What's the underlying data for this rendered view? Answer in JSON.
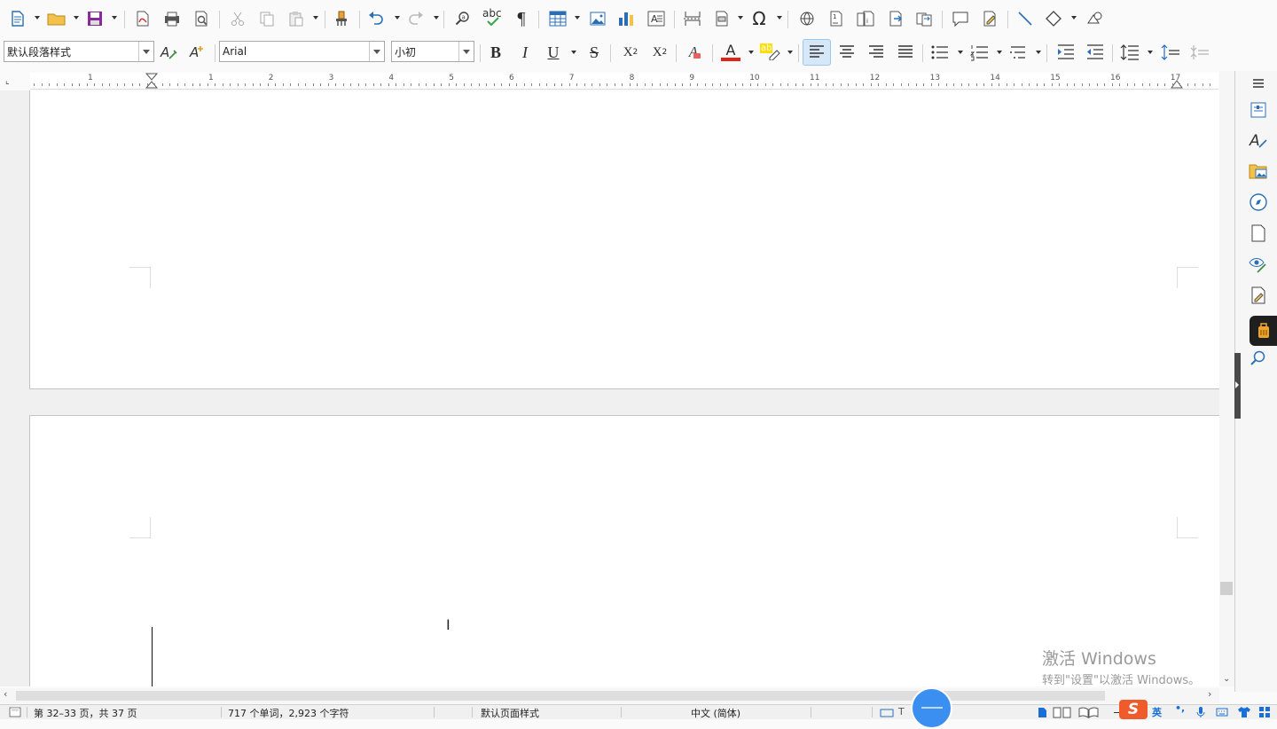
{
  "toolbar": {
    "paragraph_style": "默认段落样式",
    "font_name": "Arial",
    "font_size": "小初",
    "spelling_label": "abc",
    "bold": "B",
    "italic": "I",
    "underline": "U",
    "strike": "S",
    "font_color_letter": "A",
    "highlight_label": "ab",
    "clear_format_letter": "A",
    "superscript": "X",
    "superscript_mark": "2",
    "subscript": "X",
    "subscript_mark": "2"
  },
  "ruler": {
    "numbers": [
      "1",
      "1",
      "2",
      "3",
      "4",
      "5",
      "6",
      "7",
      "8",
      "9",
      "10",
      "11",
      "12",
      "13",
      "14",
      "15",
      "16",
      "17"
    ]
  },
  "statusbar": {
    "page_info": "第 32–33 页，共 37 页",
    "word_count": "717 个单词，2,923 个字符",
    "page_style": "默认页面样式",
    "language": "中文 (简体)",
    "ime_lang": "英",
    "ime_punct": "•,",
    "ime_logo": "S"
  },
  "watermark": {
    "title": "激活 Windows",
    "subtitle": "转到\"设置\"以激活 Windows。"
  },
  "colors": {
    "accent": "#2a7fd4",
    "font_color_bar": "#e2231a",
    "highlight_bar": "#ffde00",
    "sogou_orange": "#ef5b2a",
    "ime_blue": "#1a6fd6"
  }
}
